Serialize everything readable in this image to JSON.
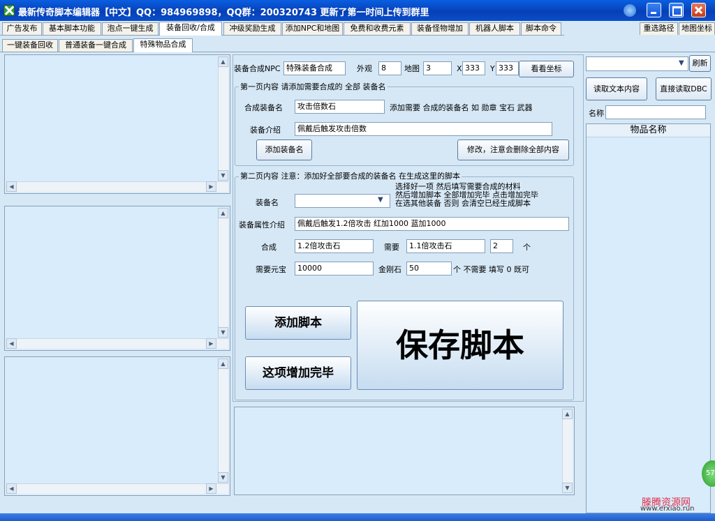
{
  "window": {
    "title": "最新传奇脚本编辑器【中文】QQ：984969898，QQ群：200320743 更新了第一时间上传到群里"
  },
  "main_tabs": [
    "广告发布",
    "基本脚本功能",
    "泡点一键生成",
    "装备回收/合成",
    "冲级奖励生成",
    "添加NPC和地图",
    "免费和收费元素",
    "装备怪物增加",
    "机器人脚本",
    "脚本命令"
  ],
  "main_tab_selected": 3,
  "right_tabs": [
    "重选路径",
    "地图坐标"
  ],
  "sub_tabs": [
    "一键装备回收",
    "普通装备一键合成",
    "特殊物品合成"
  ],
  "sub_tab_selected": 2,
  "top_row": {
    "npc_label": "装备合成NPC",
    "npc_value": "特殊装备合成",
    "look_label": "外观",
    "look_value": "8",
    "map_label": "地图",
    "map_value": "3",
    "x_label": "X",
    "x_value": "333",
    "y_label": "Y",
    "y_value": "333",
    "coord_button": "看看坐标"
  },
  "page1": {
    "title": "第一页内容 请添加需要合成的 全部 装备名",
    "name_label": "合成装备名",
    "name_value": "攻击倍数石",
    "hint": "添加需要 合成的装备名 如 勋章 宝石 武器",
    "desc_label": "装备介绍",
    "desc_value": "佩戴后触发攻击倍数",
    "add_button": "添加装备名",
    "modify_button": "修改，注意会删除全部内容"
  },
  "page2": {
    "title": "第二页内容 注意：添加好全部要合成的装备名 在生成这里的脚本",
    "equip_label": "装备名",
    "equip_value": "",
    "hint_line1": "选择好一项 然后填写需要合成的材料",
    "hint_line2": "然后增加脚本 全部增加完毕 点击增加完毕",
    "hint_line3": "在选其他装备 否则 会清空已经生成脚本",
    "attr_label": "装备属性介绍",
    "attr_value": "佩戴后触发1.2倍攻击 红加1000 蓝加1000",
    "combine_label": "合成",
    "combine_value": "1.2倍攻击石",
    "need_label": "需要",
    "need_value": "1.1倍攻击石",
    "count_value": "2",
    "count_unit": "个",
    "yuanbao_label": "需要元宝",
    "yuanbao_value": "10000",
    "diamond_label": "金刚石",
    "diamond_value": "50",
    "diamond_hint": "个 不需要 填写 0 既可"
  },
  "buttons": {
    "add_script": "添加脚本",
    "done": "这项增加完毕",
    "save_script": "保存脚本"
  },
  "right_panel": {
    "refresh_button": "刷新",
    "read_text_button": "读取文本内容",
    "read_dbc_button": "直接读取DBC",
    "name_label": "名称",
    "list_header": "物品名称"
  },
  "watermark": {
    "text": "滕腾资源网",
    "url": "www.erxiao.run"
  },
  "badge_text": "57",
  "colors": {
    "titlebar": "#0640b8",
    "panel_bg": "#d6e8f6",
    "list_bg": "#d9ecfb"
  }
}
